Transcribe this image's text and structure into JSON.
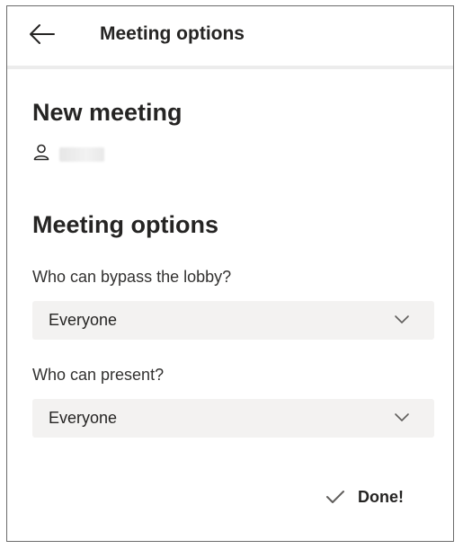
{
  "header": {
    "title": "Meeting options",
    "back_icon": "arrow-left-icon"
  },
  "meeting": {
    "title": "New meeting",
    "organizer_icon": "person-icon",
    "organizer_name": ""
  },
  "options": {
    "section_title": "Meeting options",
    "fields": [
      {
        "label": "Who can bypass the lobby?",
        "value": "Everyone",
        "icon": "chevron-down-icon"
      },
      {
        "label": "Who can present?",
        "value": "Everyone",
        "icon": "chevron-down-icon"
      }
    ]
  },
  "actions": {
    "done_label": "Done!",
    "done_icon": "checkmark-icon"
  },
  "colors": {
    "text": "#252423",
    "select_bg": "#f3f2f1",
    "border": "#6b6b6b",
    "divider": "#ececec"
  }
}
